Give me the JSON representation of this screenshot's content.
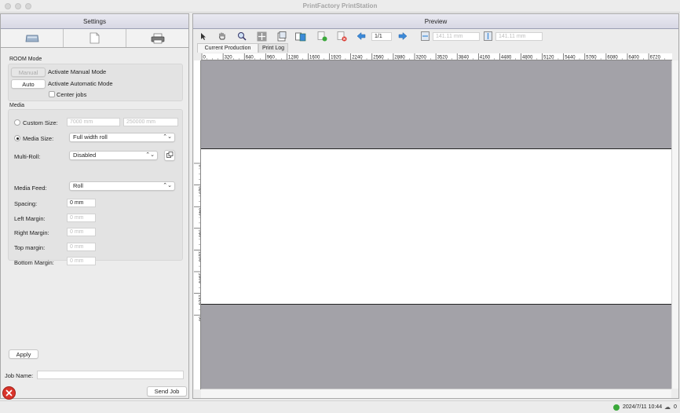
{
  "window": {
    "title": "PrintFactory PrintStation"
  },
  "settings": {
    "header": "Settings",
    "tool_tabs": [
      {
        "icon": "media-tray-icon"
      },
      {
        "icon": "document-icon"
      },
      {
        "icon": "printer-icon"
      }
    ],
    "room_mode": {
      "section_label": "ROOM Mode",
      "manual_button": "Manual",
      "manual_text": "Activate Manual Mode",
      "auto_button": "Auto",
      "auto_text": "Activate Automatic Mode",
      "center_jobs_label": "Center jobs",
      "center_jobs_checked": false
    },
    "media": {
      "section_label": "Media",
      "custom_size_label": "Custom Size:",
      "custom_size_selected": false,
      "custom_width": "7000 mm",
      "custom_length": "250000 mm",
      "media_size_label": "Media Size:",
      "media_size_selected": true,
      "media_size_value": "Full width roll",
      "multi_roll_label": "Multi-Roll:",
      "multi_roll_value": "Disabled",
      "media_feed_label": "Media Feed:",
      "media_feed_value": "Roll",
      "spacing_label": "Spacing:",
      "spacing_value": "0 mm",
      "left_margin_label": "Left Margin:",
      "left_margin_value": "0 mm",
      "right_margin_label": "Right Margin:",
      "right_margin_value": "0 mm",
      "top_margin_label": "Top margin:",
      "top_margin_value": "0 mm",
      "bottom_margin_label": "Bottom Margin:",
      "bottom_margin_value": "0 mm"
    },
    "apply_button": "Apply",
    "job_name_label": "Job Name:",
    "job_name_value": "",
    "send_job_button": "Send Job"
  },
  "preview": {
    "header": "Preview",
    "page_field": "1/1",
    "width_field": "141.11 mm",
    "height_field": "141.11 mm",
    "tabs": [
      {
        "label": "Current Production",
        "active": true
      },
      {
        "label": "Print Log",
        "active": false
      }
    ],
    "ruler_h_labels": [
      "0",
      "320",
      "640",
      "960",
      "1280",
      "1600",
      "1920",
      "2240",
      "2560",
      "2880",
      "3200",
      "3520",
      "3840",
      "4160",
      "4480",
      "4800",
      "5120",
      "5440",
      "5760",
      "6080",
      "6400",
      "6720"
    ],
    "ruler_v_labels": [
      "0",
      "320",
      "640",
      "960",
      "1280",
      "1600",
      "1920",
      "50"
    ]
  },
  "statusbar": {
    "status_color": "#3aa83a",
    "timestamp": "2024/7/11 10:44",
    "count": "0"
  },
  "colors": {
    "canvas_gray": "#a3a2a8",
    "media_white": "#ffffff",
    "close_red": "#d9342b",
    "arrow_blue": "#3c8ad8"
  }
}
